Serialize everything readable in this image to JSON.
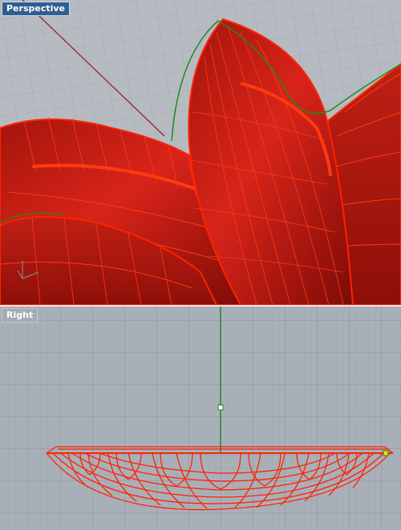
{
  "viewports": {
    "perspective": {
      "title": "Perspective",
      "active": true
    },
    "right": {
      "title": "Right",
      "active": false
    }
  },
  "colors": {
    "viewport_bg": "#b6bac1",
    "grid_minor": "#a4a9b1",
    "grid_major": "#8f959e",
    "selection_red": "#ff2200",
    "surface_red": "#c8190f",
    "curve_green": "#1f8a1f",
    "axis_red": "#9a2b2b",
    "title_active": "#2f5e91"
  },
  "icons": {
    "world_axes": "world-axes-icon"
  }
}
